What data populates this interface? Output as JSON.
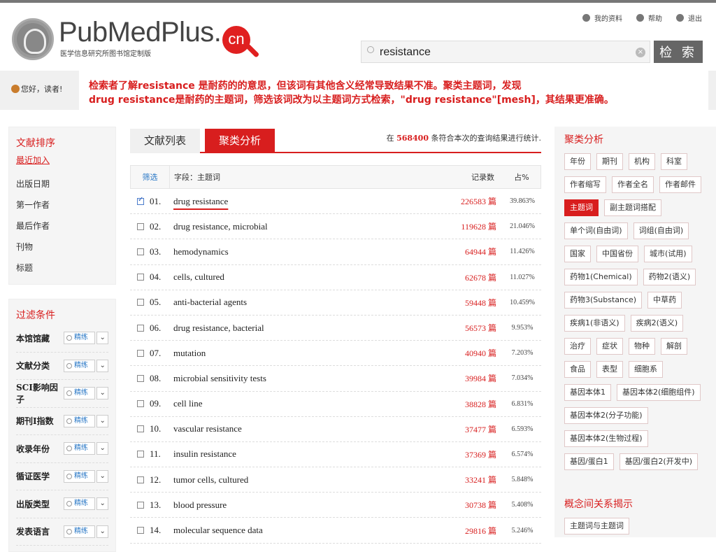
{
  "header": {
    "logo_text": "PubMedPlus.",
    "logo_cn": "cn",
    "logo_sub": "医学信息研究所图书馆定制版",
    "links": [
      "我的资料",
      "帮助",
      "退出"
    ],
    "search_value": "resistance",
    "search_button": "检 索"
  },
  "notice": {
    "greeting": "您好，读者!",
    "line1": "检索者了解resistance 是耐药的的意思，但该词有其他含义经常导致结果不准。聚类主题词，发现",
    "line2": "drug resistance是耐药的主题词，筛选该词改为以主题词方式检索，\"drug resistance\"[mesh]，其结果更准确。"
  },
  "sort": {
    "title": "文献排序",
    "items": [
      "最近加入",
      "出版日期",
      "第一作者",
      "最后作者",
      "刊物",
      "标题"
    ]
  },
  "filter": {
    "title": "过滤条件",
    "refine_label": "精练",
    "items": [
      "本馆馆藏",
      "文献分类",
      "SCI影响因子",
      "期刊I指数",
      "收录年份",
      "循证医学",
      "出版类型",
      "发表语言"
    ]
  },
  "tabs": [
    "文献列表",
    "聚类分析"
  ],
  "stat": {
    "prefix": "在",
    "count": "568400",
    "suffix": "条符合本次的查询结果进行统计."
  },
  "table": {
    "headers": [
      "筛选",
      "字段：主题词",
      "记录数",
      "占%"
    ],
    "unit": "篇",
    "rows": [
      {
        "num": "01.",
        "term": "drug resistance",
        "count": "226583",
        "pct": "39.863%",
        "checked": true
      },
      {
        "num": "02.",
        "term": "drug resistance, microbial",
        "count": "119628",
        "pct": "21.046%",
        "checked": false
      },
      {
        "num": "03.",
        "term": "hemodynamics",
        "count": "64944",
        "pct": "11.426%",
        "checked": false
      },
      {
        "num": "04.",
        "term": "cells, cultured",
        "count": "62678",
        "pct": "11.027%",
        "checked": false
      },
      {
        "num": "05.",
        "term": "anti-bacterial agents",
        "count": "59448",
        "pct": "10.459%",
        "checked": false
      },
      {
        "num": "06.",
        "term": "drug resistance, bacterial",
        "count": "56573",
        "pct": "9.953%",
        "checked": false
      },
      {
        "num": "07.",
        "term": "mutation",
        "count": "40940",
        "pct": "7.203%",
        "checked": false
      },
      {
        "num": "08.",
        "term": "microbial sensitivity tests",
        "count": "39984",
        "pct": "7.034%",
        "checked": false
      },
      {
        "num": "09.",
        "term": "cell line",
        "count": "38828",
        "pct": "6.831%",
        "checked": false
      },
      {
        "num": "10.",
        "term": "vascular resistance",
        "count": "37477",
        "pct": "6.593%",
        "checked": false
      },
      {
        "num": "11.",
        "term": "insulin resistance",
        "count": "37369",
        "pct": "6.574%",
        "checked": false
      },
      {
        "num": "12.",
        "term": "tumor cells, cultured",
        "count": "33241",
        "pct": "5.848%",
        "checked": false
      },
      {
        "num": "13.",
        "term": "blood pressure",
        "count": "30738",
        "pct": "5.408%",
        "checked": false
      },
      {
        "num": "14.",
        "term": "molecular sequence data",
        "count": "29816",
        "pct": "5.246%",
        "checked": false
      }
    ]
  },
  "cluster": {
    "title": "聚类分析",
    "chips": [
      {
        "label": "年份"
      },
      {
        "label": "期刊"
      },
      {
        "label": "机构"
      },
      {
        "label": "科室"
      },
      {
        "label": "作者缩写"
      },
      {
        "label": "作者全名"
      },
      {
        "label": "作者邮件"
      },
      {
        "label": "主题词",
        "active": true
      },
      {
        "label": "副主题词搭配"
      },
      {
        "label": "单个词(自由词)"
      },
      {
        "label": "词组(自由词)"
      },
      {
        "label": "国家"
      },
      {
        "label": "中国省份"
      },
      {
        "label": "城市(试用)"
      },
      {
        "label": "药物1(Chemical)"
      },
      {
        "label": "药物2(语义)"
      },
      {
        "label": "药物3(Substance)"
      },
      {
        "label": "中草药"
      },
      {
        "label": "疾病1(非语义)"
      },
      {
        "label": "疾病2(语义)"
      },
      {
        "label": "治疗"
      },
      {
        "label": "症状"
      },
      {
        "label": "物种"
      },
      {
        "label": "解剖"
      },
      {
        "label": "食品"
      },
      {
        "label": "表型"
      },
      {
        "label": "细胞系"
      },
      {
        "label": "基因本体1"
      },
      {
        "label": "基因本体2(细胞组件)"
      },
      {
        "label": "基因本体2(分子功能)",
        "break": true
      },
      {
        "label": "基因本体2(生物过程)",
        "break": true
      },
      {
        "label": "基因/蛋白1"
      },
      {
        "label": "基因/蛋白2(开发中)"
      }
    ],
    "relation_title": "概念间关系揭示",
    "relation_chips": [
      "主题词与主题词"
    ]
  }
}
